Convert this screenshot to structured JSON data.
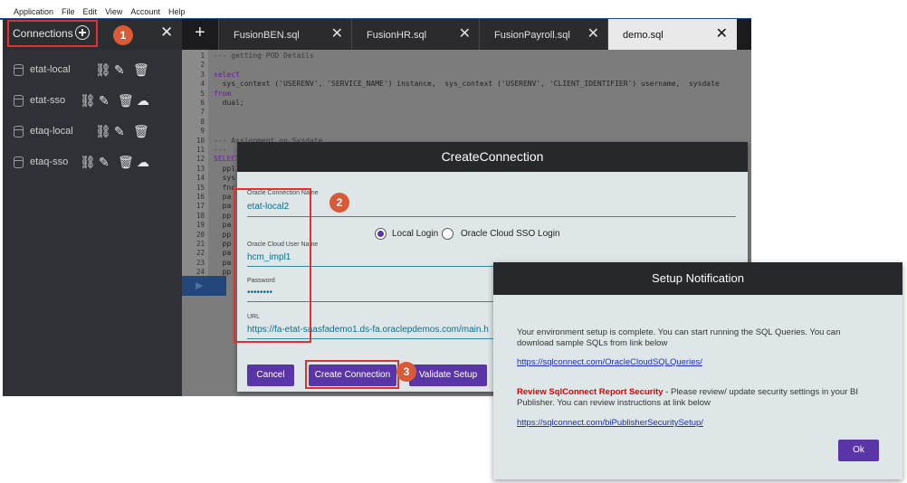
{
  "menu": [
    "Application",
    "File",
    "Edit",
    "View",
    "Account",
    "Help"
  ],
  "sidebar": {
    "title": "Connections",
    "items": [
      {
        "name": "etat-local",
        "sso": false
      },
      {
        "name": "etat-sso",
        "sso": true
      },
      {
        "name": "etaq-local",
        "sso": false
      },
      {
        "name": "etaq-sso",
        "sso": true
      }
    ]
  },
  "tabs": [
    {
      "label": "FusionBEN.sql",
      "active": false
    },
    {
      "label": "FusionHR.sql",
      "active": false
    },
    {
      "label": "FusionPayroll.sql",
      "active": false
    },
    {
      "label": "demo.sql",
      "active": true
    }
  ],
  "editor": {
    "lines": [
      "--- getting POD Details",
      "",
      "select",
      "  sys_context ('USERENV', 'SERVICE_NAME') instance,  sys_context ('USERENV', 'CLIENT_IDENTIFIER') username,  sysdate",
      "from",
      "  dual;",
      "",
      "",
      "",
      "--- Assignment on Sysdate",
      "---",
      "SELECT",
      "  ppl",
      "  sys",
      "  fnc",
      "  pa",
      "  pa",
      "  pp",
      "  pa",
      "  pp",
      "  pp",
      "  pa",
      "  pa",
      "  pp"
    ]
  },
  "dialog": {
    "title": "CreateConnection",
    "connection_name_label": "Oracle Connection Name",
    "connection_name_value": "etat-local2",
    "radio_local": "Local Login",
    "radio_sso": "Oracle Cloud SSO Login",
    "login_mode": "local",
    "user_label": "Oracle Cloud User Name",
    "user_value": "hcm_impl1",
    "password_label": "Password",
    "password_value": "••••••••",
    "url_label": "URL",
    "url_value": "https://fa-etat-saasfademo1.ds-fa.oraclepdemos.com/main.h",
    "cancel_label": "Cancel",
    "create_label": "Create Connection",
    "validate_label": "Validate Setup"
  },
  "badges": {
    "b1": "1",
    "b2": "2",
    "b3": "3"
  },
  "notification": {
    "title": "Setup Notification",
    "message": "Your environment setup is complete. You can start running the SQL Queries. You can download sample SQLs from link below",
    "link1": "https://sqlconnect.com/OracleCloudSQLQueries/",
    "warning_title": "Review SqlConnect Report Security",
    "warning_text": " - Please review/ update security settings in your BI Publisher. You can review instructions at link below",
    "link2": "https://sqlconnect.com/biPublisherSecuritySetup/",
    "ok_label": "Ok"
  },
  "colors": {
    "accent": "#5a35a8",
    "highlight": "#e03030",
    "badge": "#d85a36",
    "link": "#1c2fbf",
    "warning": "#e00000"
  }
}
